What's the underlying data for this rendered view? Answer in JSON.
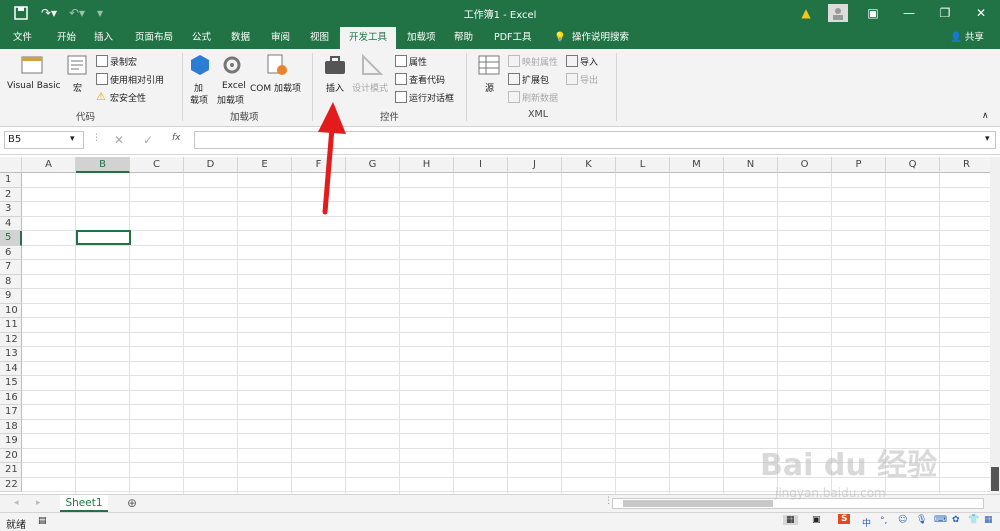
{
  "window": {
    "title": "工作簿1 - Excel"
  },
  "tabs": [
    "文件",
    "开始",
    "插入",
    "页面布局",
    "公式",
    "数据",
    "审阅",
    "视图",
    "开发工具",
    "加载项",
    "帮助",
    "PDF工具",
    "操作说明搜索"
  ],
  "active_tab": "开发工具",
  "share_label": "共享",
  "ribbon": {
    "code": {
      "label": "代码",
      "visual_basic": "Visual Basic",
      "macros": "宏",
      "record_macro": "录制宏",
      "relative_ref": "使用相对引用",
      "macro_security": "宏安全性"
    },
    "addins": {
      "label": "加载项",
      "addins_a": "加",
      "addins_b": "载项",
      "excel_a": "Excel",
      "excel_b": "加载项",
      "com": "COM 加载项"
    },
    "controls": {
      "label": "控件",
      "insert": "插入",
      "design_mode": "设计模式",
      "properties": "属性",
      "view_code": "查看代码",
      "run_dialog": "运行对话框"
    },
    "xml": {
      "label": "XML",
      "source": "源",
      "map_props": "映射属性",
      "expansion": "扩展包",
      "refresh": "刷新数据",
      "import": "导入",
      "export": "导出"
    }
  },
  "formula_bar": {
    "name_box": "B5",
    "fx": "fx",
    "value": ""
  },
  "columns": [
    "A",
    "B",
    "C",
    "D",
    "E",
    "F",
    "G",
    "H",
    "I",
    "J",
    "K",
    "L",
    "M",
    "N",
    "O",
    "P",
    "Q",
    "R"
  ],
  "rows": [
    "1",
    "2",
    "3",
    "4",
    "5",
    "6",
    "7",
    "8",
    "9",
    "10",
    "11",
    "12",
    "13",
    "14",
    "15",
    "16",
    "17",
    "18",
    "19",
    "20",
    "21",
    "22"
  ],
  "selected_cell": {
    "col": "B",
    "row": "5"
  },
  "sheet_tabs": [
    "Sheet1"
  ],
  "status": {
    "ready": "就绪"
  },
  "watermark": {
    "text": "Bai du 经验",
    "sub": "jingyan.baidu.com"
  },
  "colors": {
    "brand": "#217346",
    "arrow": "#e31b1b"
  }
}
